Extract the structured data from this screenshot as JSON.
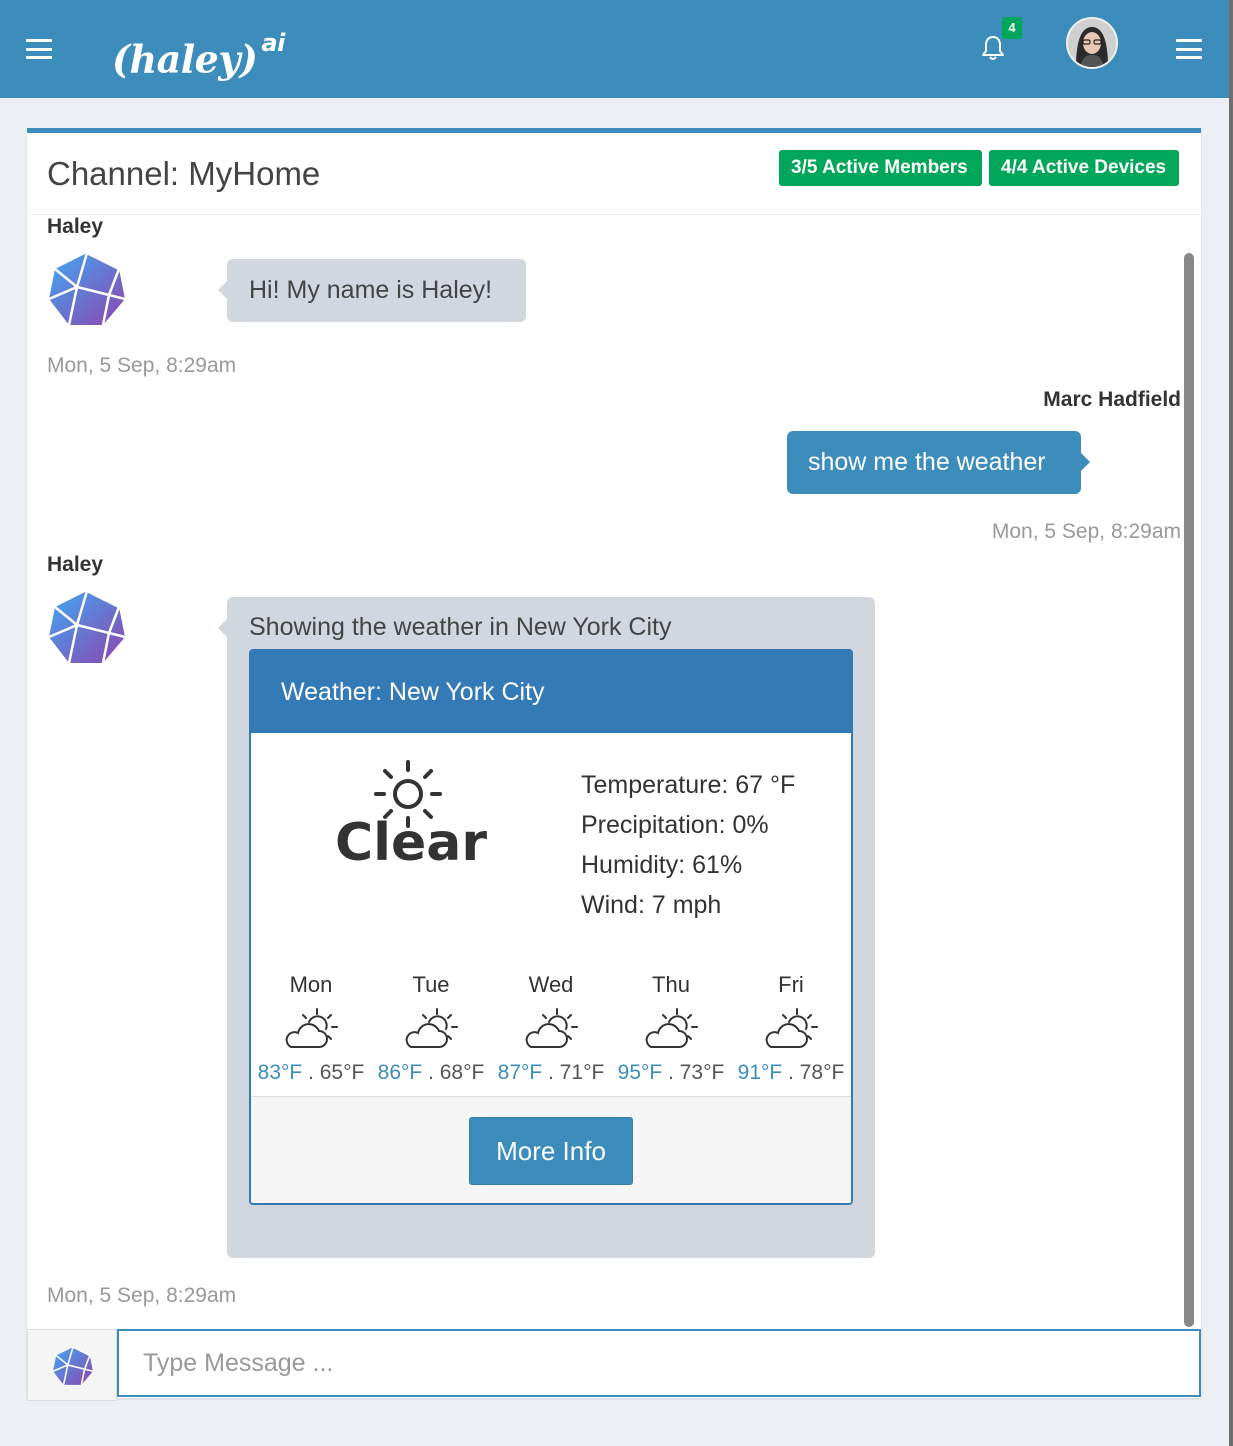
{
  "header": {
    "logo_text": "(haley)",
    "logo_sup": "ai",
    "notification_count": "4"
  },
  "channel": {
    "title": "Channel: MyHome",
    "members_label": "3/5 Active Members",
    "devices_label": "4/4 Active Devices"
  },
  "messages": [
    {
      "sender": "Haley",
      "text": "Hi! My name is Haley!",
      "time": "Mon, 5 Sep, 8:29am"
    },
    {
      "sender": "Marc Hadfield",
      "text": "show me the weather",
      "time": "Mon, 5 Sep, 8:29am"
    },
    {
      "sender": "Haley",
      "text": "Showing the weather in New York City",
      "time": "Mon, 5 Sep, 8:29am"
    }
  ],
  "weather": {
    "title": "Weather: New York City",
    "summary": "Clear",
    "current_icon": "sun-icon",
    "stats": {
      "temperature": "Temperature: 67 °F",
      "precipitation": "Precipitation: 0%",
      "humidity": "Humidity: 61%",
      "wind": "Wind: 7 mph"
    },
    "forecast": [
      {
        "day": "Mon",
        "high": "83°F",
        "low": " . 65°F",
        "icon": "partly-cloudy-icon"
      },
      {
        "day": "Tue",
        "high": "86°F",
        "low": " . 68°F",
        "icon": "partly-cloudy-icon"
      },
      {
        "day": "Wed",
        "high": "87°F",
        "low": " . 71°F",
        "icon": "partly-cloudy-icon"
      },
      {
        "day": "Thu",
        "high": "95°F",
        "low": " . 73°F",
        "icon": "partly-cloudy-icon"
      },
      {
        "day": "Fri",
        "high": "91°F",
        "low": " . 78°F",
        "icon": "partly-cloudy-icon"
      }
    ],
    "more_info_label": "More Info"
  },
  "composer": {
    "placeholder": "Type Message ..."
  },
  "colors": {
    "primary": "#3c8dbc",
    "panel_blue": "#337ab7",
    "success": "#00a65a",
    "bubble_grey": "#d2d6de"
  }
}
